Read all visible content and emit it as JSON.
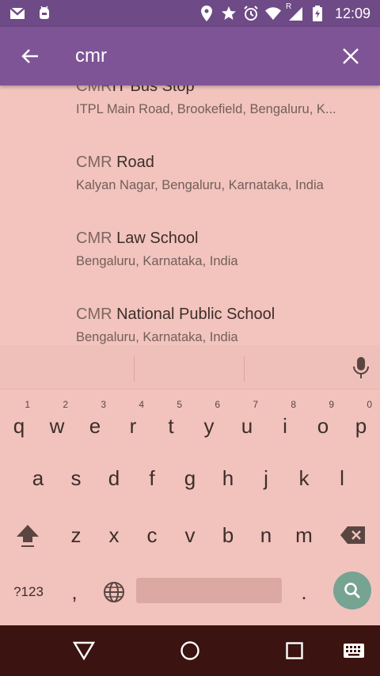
{
  "status_bar": {
    "time": "12:09",
    "icons_left": [
      "gmail-icon",
      "android-debug-icon"
    ],
    "icons_right": [
      "location-icon",
      "star-icon",
      "alarm-icon",
      "wifi-icon",
      "signal-icon",
      "battery-charging-icon"
    ],
    "roaming_label": "R"
  },
  "search": {
    "query": "cmr",
    "back_icon": "arrow-back-icon",
    "clear_icon": "close-icon"
  },
  "results": [
    {
      "match": "CMR",
      "rest": "IT Bus Stop",
      "subtitle": "ITPL Main Road, Brookefield, Bengaluru, K..."
    },
    {
      "match": "CMR",
      "rest": " Road",
      "subtitle": "Kalyan Nagar, Bengaluru, Karnataka, India"
    },
    {
      "match": "CMR",
      "rest": " Law School",
      "subtitle": "Bengaluru, Karnataka, India"
    },
    {
      "match": "CMR",
      "rest": " National Public School",
      "subtitle": "Bengaluru, Karnataka, India"
    }
  ],
  "keyboard": {
    "row1": [
      {
        "key": "q",
        "hint": "1"
      },
      {
        "key": "w",
        "hint": "2"
      },
      {
        "key": "e",
        "hint": "3"
      },
      {
        "key": "r",
        "hint": "4"
      },
      {
        "key": "t",
        "hint": "5"
      },
      {
        "key": "y",
        "hint": "6"
      },
      {
        "key": "u",
        "hint": "7"
      },
      {
        "key": "i",
        "hint": "8"
      },
      {
        "key": "o",
        "hint": "9"
      },
      {
        "key": "p",
        "hint": "0"
      }
    ],
    "row2": [
      "a",
      "s",
      "d",
      "f",
      "g",
      "h",
      "j",
      "k",
      "l"
    ],
    "row3": [
      "z",
      "x",
      "c",
      "v",
      "b",
      "n",
      "m"
    ],
    "symbols_label": "?123",
    "comma_label": ",",
    "period_label": ".",
    "mic_icon": "microphone-icon",
    "shift_icon": "shift-icon",
    "backspace_icon": "backspace-icon",
    "globe_icon": "globe-icon",
    "search_icon": "search-icon",
    "search_key_color": "#77a393"
  },
  "nav_bar": {
    "back_icon": "nav-back-icon",
    "home_icon": "nav-home-icon",
    "recents_icon": "nav-recents-icon",
    "keyboard_switch_icon": "keyboard-icon"
  },
  "colors": {
    "status_bar": "#6e4a86",
    "app_bar": "#7f5496",
    "background": "#f2c4bd",
    "nav_bar": "#3b1310"
  }
}
